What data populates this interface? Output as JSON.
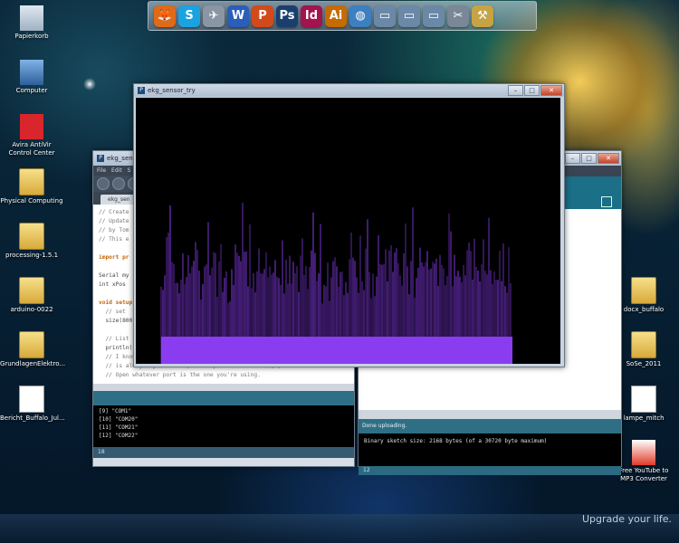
{
  "dock": {
    "icons": [
      {
        "icon": "firefox-icon",
        "color": "#e06a17",
        "glyph": "🦊"
      },
      {
        "icon": "skype-icon",
        "color": "#1aa3e0",
        "glyph": "S"
      },
      {
        "icon": "plane-icon",
        "color": "#8a96a3",
        "glyph": "✈"
      },
      {
        "icon": "word-icon",
        "color": "#2a5eb8",
        "glyph": "W"
      },
      {
        "icon": "powerpoint-icon",
        "color": "#d24a1b",
        "glyph": "P"
      },
      {
        "icon": "photoshop-icon",
        "color": "#1a3e6e",
        "glyph": "Ps"
      },
      {
        "icon": "indesign-icon",
        "color": "#a3134e",
        "glyph": "Id"
      },
      {
        "icon": "illustrator-icon",
        "color": "#c56b00",
        "glyph": "Ai"
      },
      {
        "icon": "globe-icon",
        "color": "#3e7fc0",
        "glyph": "◍"
      },
      {
        "icon": "folder-icon",
        "color": "#6b88a6",
        "glyph": "▭"
      },
      {
        "icon": "folder-icon",
        "color": "#6b88a6",
        "glyph": "▭"
      },
      {
        "icon": "folder-icon",
        "color": "#6b88a6",
        "glyph": "▭"
      },
      {
        "icon": "tools-icon",
        "color": "#7a8796",
        "glyph": "✂"
      },
      {
        "icon": "hammer-icon",
        "color": "#c6a445",
        "glyph": "⚒"
      }
    ]
  },
  "desktop_icons": {
    "left": [
      {
        "label": "Papierkorb",
        "icon": "recycle-bin-icon"
      },
      {
        "label": "Computer",
        "icon": "computer-icon"
      },
      {
        "label": "Avira AntiVir Control Center",
        "icon": "avira-icon"
      },
      {
        "label": "Physical Computing",
        "icon": "folder-icon"
      },
      {
        "label": "processing-1.5.1",
        "icon": "folder-icon"
      },
      {
        "label": "arduino-0022",
        "icon": "folder-icon"
      },
      {
        "label": "GrundlagenElektro...",
        "icon": "folder-icon"
      },
      {
        "label": "Bericht_Buffalo_Jul...",
        "icon": "word-doc-icon"
      }
    ],
    "right": [
      {
        "label": "docx_buffalo",
        "icon": "folder-icon"
      },
      {
        "label": "SoSe_2011",
        "icon": "folder-icon"
      },
      {
        "label": "lampe_mitch",
        "icon": "file-icon"
      },
      {
        "label": "Free YouTube to MP3 Converter",
        "icon": "converter-icon"
      }
    ]
  },
  "sketch_window": {
    "title": "ekg_sens",
    "menu": [
      "File",
      "Edit",
      "S"
    ],
    "tab": "ekg_sen",
    "code": [
      {
        "t": "// Create",
        "c": "c"
      },
      {
        "t": "// Update",
        "c": "c"
      },
      {
        "t": "// by Tom",
        "c": "c"
      },
      {
        "t": "// This e",
        "c": "c"
      },
      {
        "t": "",
        "c": ""
      },
      {
        "t": "import pr",
        "c": "k"
      },
      {
        "t": "",
        "c": ""
      },
      {
        "t": "Serial my",
        "c": ""
      },
      {
        "t": "int xPos",
        "c": ""
      },
      {
        "t": "",
        "c": ""
      },
      {
        "t": "void setup",
        "c": "k"
      },
      {
        "t": "  // set",
        "c": "c"
      },
      {
        "t": "  size(800",
        "c": ""
      },
      {
        "t": "",
        "c": ""
      },
      {
        "t": "  // List",
        "c": "c"
      },
      {
        "t": "  println(",
        "c": ""
      },
      {
        "t": "  // I know that the first port in the serial list on my mac",
        "c": "c"
      },
      {
        "t": "  // is always my  Arduino, so I open Serial.list()[0].",
        "c": "c"
      },
      {
        "t": "  // Open whatever port is the one you're using.",
        "c": "c"
      }
    ],
    "console": [
      "[9] \"COM1\"",
      "[10] \"COM20\"",
      "[11] \"COM21\"",
      "[12] \"COM22\""
    ],
    "status": "18"
  },
  "arduino_window": {
    "message": "Done uploading.",
    "console": "Binary sketch size: 2168 bytes (of a 30720 byte maximum)",
    "status": "12"
  },
  "graph_window": {
    "title": "ekg_sensor_try",
    "colors": {
      "background": "#000000",
      "trace": "#8a3cf0"
    }
  },
  "taskbar": {
    "slogan": "Upgrade your life."
  }
}
